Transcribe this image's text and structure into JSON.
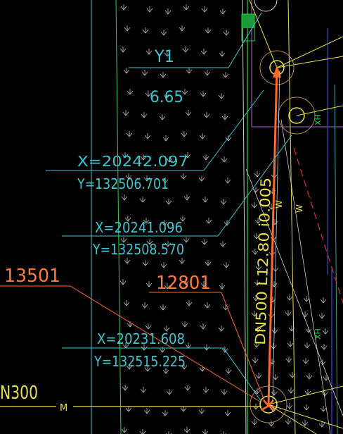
{
  "colors": {
    "background": "#000000",
    "cyan": "#3fc4d0",
    "green": "#2fd04a",
    "yellow": "#e6e04a",
    "white_grey": "#cfcfcf",
    "hatch": "#bdbdbd",
    "orange": "#ff6a2a",
    "orange_text": "#ff7a3a",
    "red_dash": "#d8322c",
    "blue": "#3a46e0",
    "magenta": "#b060d8",
    "teal_pipe": "#2aa89a"
  },
  "labels": {
    "node_name": "Y1",
    "node_elevation": "6.65",
    "coord1_x": "X=20242.097",
    "coord1_y": "Y=132506.701",
    "coord2_x": "X=20241.096",
    "coord2_y": "Y=132508.570",
    "coord3_x": "X=20231.608",
    "coord3_y": "Y=132515.225",
    "tag_left": "13501",
    "tag_center": "12801",
    "pipe_label": "DN500 L12.80 i0.005",
    "pipe_left": "N300",
    "w_mark_1": "W",
    "w_mark_2": "W",
    "m_mark": "M",
    "xh_mark_1": "XH",
    "xh_mark_2": "XH"
  },
  "icons": {
    "manhole_top": "manhole-circle-icon",
    "manhole_mid": "manhole-circle-icon",
    "manhole_bottom": "manhole-circle-icon",
    "flow_arrow": "arrow-up-icon",
    "fill_block": "green-fill-block-icon"
  }
}
